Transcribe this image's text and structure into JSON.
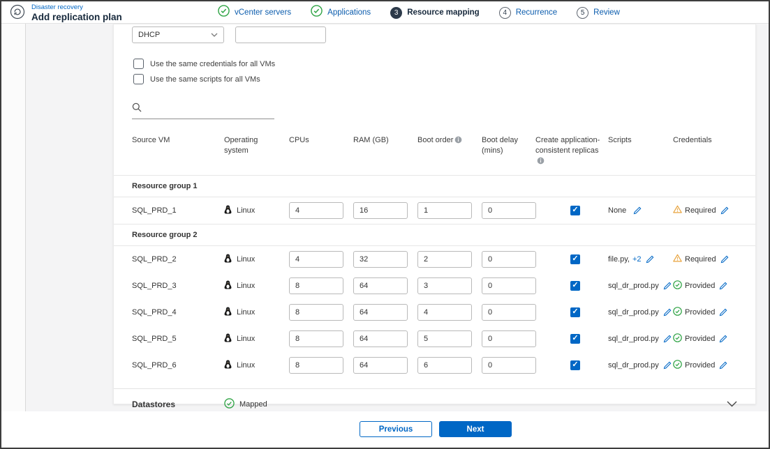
{
  "header": {
    "breadcrumb": "Disaster recovery",
    "title": "Add replication plan",
    "steps": [
      {
        "label": "vCenter servers",
        "state": "done"
      },
      {
        "label": "Applications",
        "state": "done"
      },
      {
        "number": "3",
        "label": "Resource mapping",
        "state": "active"
      },
      {
        "number": "4",
        "label": "Recurrence",
        "state": "todo"
      },
      {
        "number": "5",
        "label": "Review",
        "state": "todo"
      }
    ]
  },
  "controls": {
    "ip_type_value": "DHCP",
    "ip_value": "",
    "same_credentials_label": "Use the same credentials for all VMs",
    "same_scripts_label": "Use the same scripts for all VMs",
    "search_value": ""
  },
  "table": {
    "headers": {
      "source_vm": "Source VM",
      "os": "Operating system",
      "cpus": "CPUs",
      "ram": "RAM (GB)",
      "boot_order": "Boot order",
      "boot_delay": "Boot delay (mins)",
      "app_consistent": "Create application-consistent replicas",
      "scripts": "Scripts",
      "credentials": "Credentials"
    },
    "groups": [
      {
        "name": "Resource group 1",
        "rows": [
          {
            "name": "SQL_PRD_1",
            "os": "Linux",
            "cpus": "4",
            "ram": "16",
            "boot_order": "1",
            "boot_delay": "0",
            "app_consistent": true,
            "scripts": "None",
            "scripts_more": "",
            "credentials": "Required",
            "credentials_state": "warning"
          }
        ]
      },
      {
        "name": "Resource group 2",
        "rows": [
          {
            "name": "SQL_PRD_2",
            "os": "Linux",
            "cpus": "4",
            "ram": "32",
            "boot_order": "2",
            "boot_delay": "0",
            "app_consistent": true,
            "scripts": "file.py,",
            "scripts_more": "+2",
            "credentials": "Required",
            "credentials_state": "warning"
          },
          {
            "name": "SQL_PRD_3",
            "os": "Linux",
            "cpus": "8",
            "ram": "64",
            "boot_order": "3",
            "boot_delay": "0",
            "app_consistent": true,
            "scripts": "sql_dr_prod.py",
            "scripts_more": "",
            "credentials": "Provided",
            "credentials_state": "ok"
          },
          {
            "name": "SQL_PRD_4",
            "os": "Linux",
            "cpus": "8",
            "ram": "64",
            "boot_order": "4",
            "boot_delay": "0",
            "app_consistent": true,
            "scripts": "sql_dr_prod.py",
            "scripts_more": "",
            "credentials": "Provided",
            "credentials_state": "ok"
          },
          {
            "name": "SQL_PRD_5",
            "os": "Linux",
            "cpus": "8",
            "ram": "64",
            "boot_order": "5",
            "boot_delay": "0",
            "app_consistent": true,
            "scripts": "sql_dr_prod.py",
            "scripts_more": "",
            "credentials": "Provided",
            "credentials_state": "ok"
          },
          {
            "name": "SQL_PRD_6",
            "os": "Linux",
            "cpus": "8",
            "ram": "64",
            "boot_order": "6",
            "boot_delay": "0",
            "app_consistent": true,
            "scripts": "sql_dr_prod.py",
            "scripts_more": "",
            "credentials": "Provided",
            "credentials_state": "ok"
          }
        ]
      }
    ]
  },
  "datastores": {
    "title": "Datastores",
    "status": "Mapped"
  },
  "footer": {
    "previous_label": "Previous",
    "next_label": "Next"
  },
  "colors": {
    "accent": "#0067C5",
    "green": "#2DA343",
    "warning": "#E8A33D",
    "step_active": "#2D3A4A"
  }
}
